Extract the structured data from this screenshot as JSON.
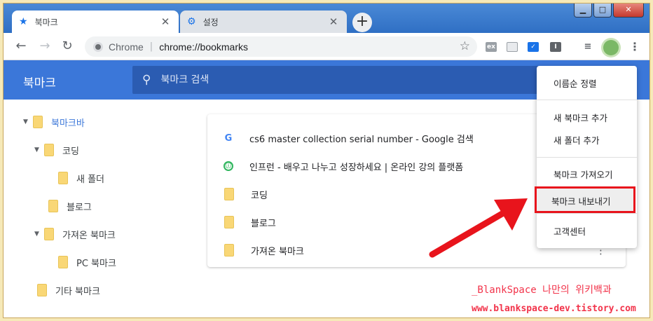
{
  "tabs": [
    {
      "title": "북마크",
      "icon": "star-icon"
    },
    {
      "title": "설정",
      "icon": "gear-icon"
    }
  ],
  "window_controls": {
    "minimize": "▁",
    "maximize": "□",
    "close": "✕"
  },
  "omnibox": {
    "site": "Chrome",
    "url": "chrome://bookmarks"
  },
  "header": {
    "title": "북마크",
    "search_placeholder": "북마크 검색"
  },
  "tree": [
    {
      "label": "북마크바",
      "expanded": true,
      "selected": true
    },
    {
      "label": "코딩",
      "expanded": true
    },
    {
      "label": "새 폴더"
    },
    {
      "label": "블로그"
    },
    {
      "label": "가져온 북마크",
      "expanded": true
    },
    {
      "label": "PC 북마크"
    },
    {
      "label": "기타 북마크"
    }
  ],
  "list": [
    {
      "title": "cs6 master collection serial number - Google 검색",
      "type": "google-favicon"
    },
    {
      "title": "인프런 - 배우고 나누고 성장하세요 | 온라인 강의 플랫폼",
      "type": "inflearn-favicon"
    },
    {
      "title": "코딩",
      "type": "folder"
    },
    {
      "title": "블로그",
      "type": "folder"
    },
    {
      "title": "가져온 북마크",
      "type": "folder"
    }
  ],
  "menu": {
    "sort": "이름순 정렬",
    "add_bookmark": "새 북마크 추가",
    "add_folder": "새 폴더 추가",
    "import": "북마크 가져오기",
    "export": "북마크 내보내기",
    "help": "고객센터"
  },
  "watermark": {
    "line1": "_BlankSpace 나만의 위키백과",
    "line2": "www.blankspace-dev.tistory.com"
  },
  "colors": {
    "accent": "#3b77d9",
    "highlight": "#e8141c",
    "folder": "#f9d776"
  }
}
